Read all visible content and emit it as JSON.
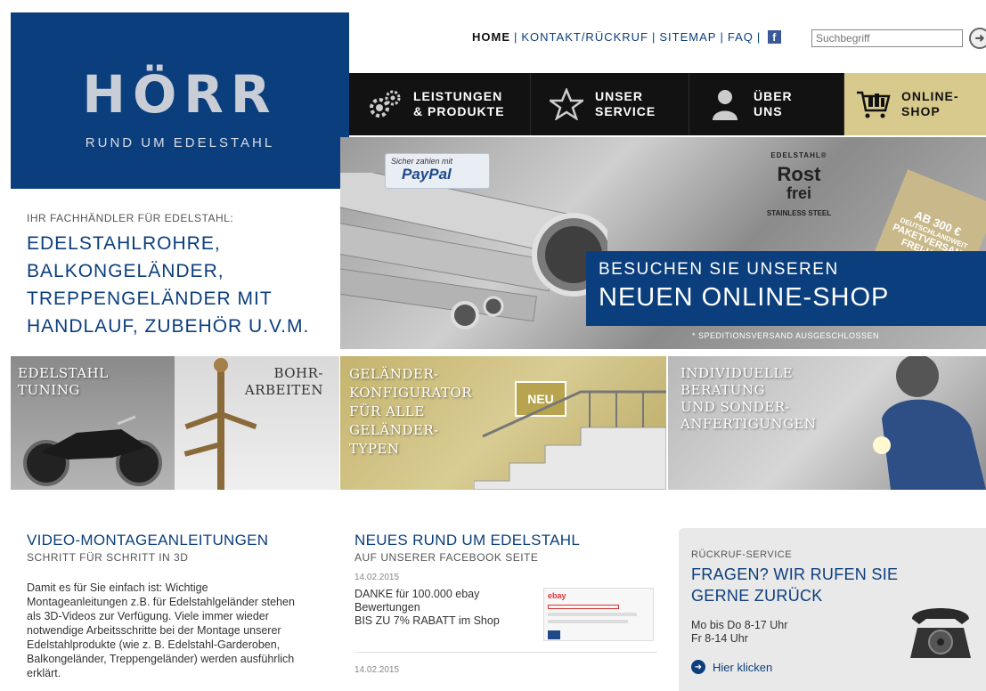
{
  "logo": {
    "text": "HÖRR",
    "subtitle": "RUND UM EDELSTAHL"
  },
  "topnav": {
    "home": "HOME",
    "kontakt": "KONTAKT/RÜCKRUF",
    "sitemap": "SITEMAP",
    "faq": "FAQ",
    "separator": "|",
    "facebook_letter": "f"
  },
  "search": {
    "placeholder": "Suchbegriff",
    "go_symbol": "➜"
  },
  "mainnav": {
    "leistungen": [
      "LEISTUNGEN",
      "& PRODUKTE"
    ],
    "service": [
      "UNSER",
      "SERVICE"
    ],
    "ueber": [
      "ÜBER",
      "UNS"
    ],
    "shop": [
      "ONLINE-",
      "SHOP"
    ]
  },
  "tagline": {
    "small": "IHR FACHHÄNDLER FÜR EDELSTAHL:",
    "lines": [
      "EDELSTAHLROHRE,",
      "BALKONGELÄNDER,",
      "TREPPENGELÄNDER MIT",
      "HANDLAUF, ZUBEHÖR U.V.M."
    ]
  },
  "hero": {
    "paypal_small": "Sicher zahlen mit",
    "paypal_logo": "PayPal",
    "rostfrei": [
      "EDELSTAHL®",
      "Rost",
      "frei",
      "STAINLESS STEEL"
    ],
    "price_tag": [
      "AB 300 €",
      "DEUTSCHLANDWEIT",
      "PAKETVERSAND",
      "FREI-HAUS"
    ],
    "banner_line1": "BESUCHEN SIE UNSEREN",
    "banner_line2": "NEUEN ONLINE-SHOP",
    "note": "* SPEDITIONSVERSAND AUSGESCHLOSSEN"
  },
  "tiles": {
    "tuning": [
      "EDELSTAHL",
      "TUNING"
    ],
    "bohr": [
      "BOHR-",
      "ARBEITEN"
    ],
    "konfig": [
      "GELÄNDER-",
      "KONFIGURATOR",
      "FÜR ALLE",
      "GELÄNDER-",
      "TYPEN"
    ],
    "konfig_badge": "NEU",
    "beratung": [
      "INDIVIDUELLE",
      "BERATUNG",
      "UND SONDER-",
      "ANFERTIGUNGEN"
    ]
  },
  "video": {
    "title": "VIDEO-MONTAGEANLEITUNGEN",
    "subtitle": "SCHRITT FÜR SCHRITT IN 3D",
    "body": "Damit es für Sie einfach ist: Wichtige Montageanleitungen z.B. für Edelstahlgeländer stehen als 3D-Videos zur Verfügung. Viele immer wieder notwendige Arbeitsschritte bei der Montage unserer Edelstahlprodukte (wie z. B. Edelstahl-Garderoben, Balkongeländer, Treppengeländer) werden ausführlich erklärt."
  },
  "news": {
    "title": "NEUES RUND UM EDELSTAHL",
    "subtitle": "AUF UNSERER FACEBOOK SEITE",
    "items": [
      {
        "date": "14.02.2015",
        "line1": "DANKE für 100.000 ebay",
        "line2": "Bewertungen",
        "line3": "BIS ZU 7% RABATT im Shop",
        "thumb_logo": "ebay"
      },
      {
        "date": "14.02.2015"
      }
    ]
  },
  "callback": {
    "small": "RÜCKRUF-SERVICE",
    "big": "FRAGEN? WIR RUFEN SIE GERNE ZURÜCK",
    "hours1": "Mo bis Do 8-17 Uhr",
    "hours2": "Fr 8-14 Uhr",
    "link": "Hier klicken"
  },
  "colors": {
    "brand_blue": "#0b3e7d",
    "gold": "#d8c98c",
    "nav_black": "#121212"
  }
}
